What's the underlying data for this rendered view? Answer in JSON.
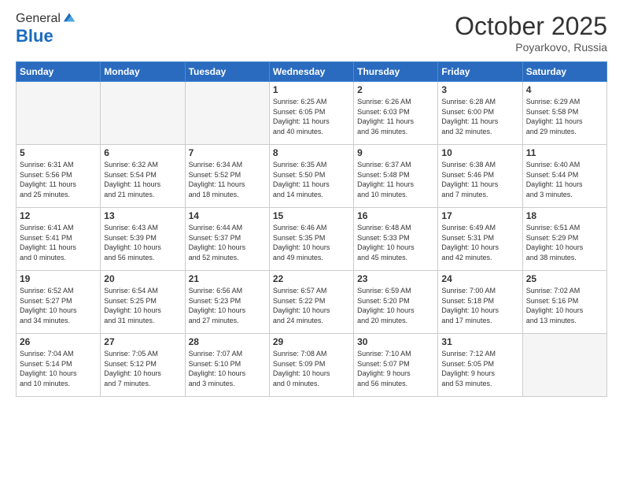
{
  "header": {
    "logo_general": "General",
    "logo_blue": "Blue",
    "month": "October 2025",
    "location": "Poyarkovo, Russia"
  },
  "weekdays": [
    "Sunday",
    "Monday",
    "Tuesday",
    "Wednesday",
    "Thursday",
    "Friday",
    "Saturday"
  ],
  "weeks": [
    [
      {
        "day": "",
        "info": ""
      },
      {
        "day": "",
        "info": ""
      },
      {
        "day": "",
        "info": ""
      },
      {
        "day": "1",
        "info": "Sunrise: 6:25 AM\nSunset: 6:05 PM\nDaylight: 11 hours\nand 40 minutes."
      },
      {
        "day": "2",
        "info": "Sunrise: 6:26 AM\nSunset: 6:03 PM\nDaylight: 11 hours\nand 36 minutes."
      },
      {
        "day": "3",
        "info": "Sunrise: 6:28 AM\nSunset: 6:00 PM\nDaylight: 11 hours\nand 32 minutes."
      },
      {
        "day": "4",
        "info": "Sunrise: 6:29 AM\nSunset: 5:58 PM\nDaylight: 11 hours\nand 29 minutes."
      }
    ],
    [
      {
        "day": "5",
        "info": "Sunrise: 6:31 AM\nSunset: 5:56 PM\nDaylight: 11 hours\nand 25 minutes."
      },
      {
        "day": "6",
        "info": "Sunrise: 6:32 AM\nSunset: 5:54 PM\nDaylight: 11 hours\nand 21 minutes."
      },
      {
        "day": "7",
        "info": "Sunrise: 6:34 AM\nSunset: 5:52 PM\nDaylight: 11 hours\nand 18 minutes."
      },
      {
        "day": "8",
        "info": "Sunrise: 6:35 AM\nSunset: 5:50 PM\nDaylight: 11 hours\nand 14 minutes."
      },
      {
        "day": "9",
        "info": "Sunrise: 6:37 AM\nSunset: 5:48 PM\nDaylight: 11 hours\nand 10 minutes."
      },
      {
        "day": "10",
        "info": "Sunrise: 6:38 AM\nSunset: 5:46 PM\nDaylight: 11 hours\nand 7 minutes."
      },
      {
        "day": "11",
        "info": "Sunrise: 6:40 AM\nSunset: 5:44 PM\nDaylight: 11 hours\nand 3 minutes."
      }
    ],
    [
      {
        "day": "12",
        "info": "Sunrise: 6:41 AM\nSunset: 5:41 PM\nDaylight: 11 hours\nand 0 minutes."
      },
      {
        "day": "13",
        "info": "Sunrise: 6:43 AM\nSunset: 5:39 PM\nDaylight: 10 hours\nand 56 minutes."
      },
      {
        "day": "14",
        "info": "Sunrise: 6:44 AM\nSunset: 5:37 PM\nDaylight: 10 hours\nand 52 minutes."
      },
      {
        "day": "15",
        "info": "Sunrise: 6:46 AM\nSunset: 5:35 PM\nDaylight: 10 hours\nand 49 minutes."
      },
      {
        "day": "16",
        "info": "Sunrise: 6:48 AM\nSunset: 5:33 PM\nDaylight: 10 hours\nand 45 minutes."
      },
      {
        "day": "17",
        "info": "Sunrise: 6:49 AM\nSunset: 5:31 PM\nDaylight: 10 hours\nand 42 minutes."
      },
      {
        "day": "18",
        "info": "Sunrise: 6:51 AM\nSunset: 5:29 PM\nDaylight: 10 hours\nand 38 minutes."
      }
    ],
    [
      {
        "day": "19",
        "info": "Sunrise: 6:52 AM\nSunset: 5:27 PM\nDaylight: 10 hours\nand 34 minutes."
      },
      {
        "day": "20",
        "info": "Sunrise: 6:54 AM\nSunset: 5:25 PM\nDaylight: 10 hours\nand 31 minutes."
      },
      {
        "day": "21",
        "info": "Sunrise: 6:56 AM\nSunset: 5:23 PM\nDaylight: 10 hours\nand 27 minutes."
      },
      {
        "day": "22",
        "info": "Sunrise: 6:57 AM\nSunset: 5:22 PM\nDaylight: 10 hours\nand 24 minutes."
      },
      {
        "day": "23",
        "info": "Sunrise: 6:59 AM\nSunset: 5:20 PM\nDaylight: 10 hours\nand 20 minutes."
      },
      {
        "day": "24",
        "info": "Sunrise: 7:00 AM\nSunset: 5:18 PM\nDaylight: 10 hours\nand 17 minutes."
      },
      {
        "day": "25",
        "info": "Sunrise: 7:02 AM\nSunset: 5:16 PM\nDaylight: 10 hours\nand 13 minutes."
      }
    ],
    [
      {
        "day": "26",
        "info": "Sunrise: 7:04 AM\nSunset: 5:14 PM\nDaylight: 10 hours\nand 10 minutes."
      },
      {
        "day": "27",
        "info": "Sunrise: 7:05 AM\nSunset: 5:12 PM\nDaylight: 10 hours\nand 7 minutes."
      },
      {
        "day": "28",
        "info": "Sunrise: 7:07 AM\nSunset: 5:10 PM\nDaylight: 10 hours\nand 3 minutes."
      },
      {
        "day": "29",
        "info": "Sunrise: 7:08 AM\nSunset: 5:09 PM\nDaylight: 10 hours\nand 0 minutes."
      },
      {
        "day": "30",
        "info": "Sunrise: 7:10 AM\nSunset: 5:07 PM\nDaylight: 9 hours\nand 56 minutes."
      },
      {
        "day": "31",
        "info": "Sunrise: 7:12 AM\nSunset: 5:05 PM\nDaylight: 9 hours\nand 53 minutes."
      },
      {
        "day": "",
        "info": ""
      }
    ]
  ]
}
